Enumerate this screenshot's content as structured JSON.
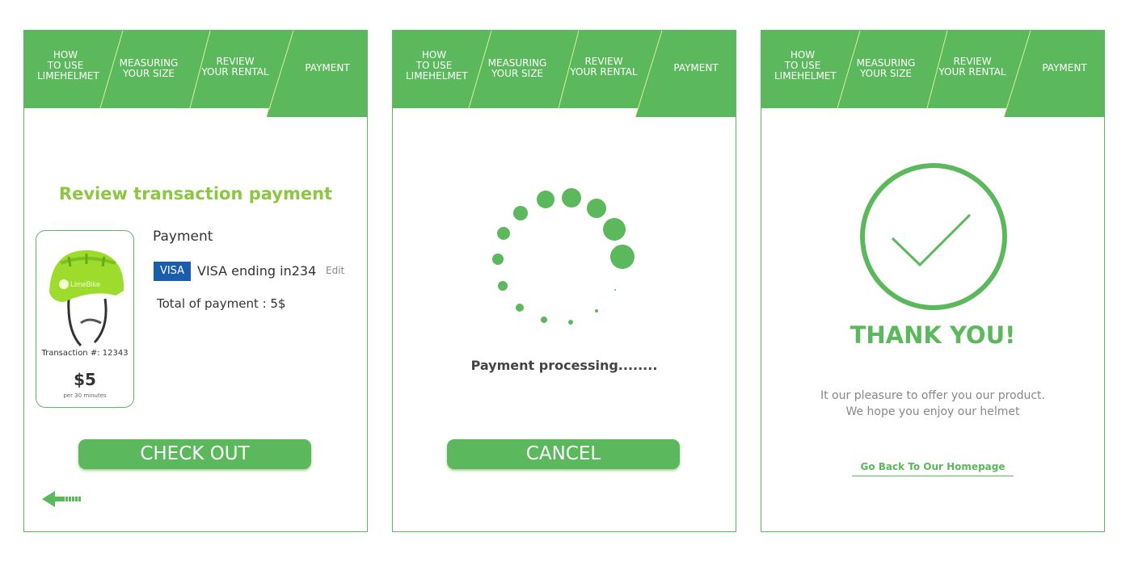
{
  "tabs": [
    {
      "label": "HOW\nTO USE\nLIMEHELMET"
    },
    {
      "label": "MEASURING\nYOUR SIZE"
    },
    {
      "label": "REVIEW\nYOUR RENTAL"
    },
    {
      "label": "PAYMENT"
    }
  ],
  "colors": {
    "accent": "#5cb85c",
    "lime": "#8dc63f",
    "visa": "#1a5dab"
  },
  "review": {
    "title": "Review transaction payment",
    "helmet_brand": "LimeBike",
    "transaction": "Transaction #: 12343",
    "price": "$5",
    "price_unit": "per 30 minutes",
    "payment_heading": "Payment",
    "visa_badge": "VISA",
    "card_text": "VISA ending in234",
    "edit": "Edit",
    "total": "Total of payment : 5$",
    "checkout": "CHECK OUT",
    "back_icon": "back-arrow-icon"
  },
  "processing": {
    "status": "Payment processing........",
    "cancel": "CANCEL"
  },
  "thanks": {
    "title": "THANK YOU!",
    "message_line1": "It our pleasure to offer you our product.",
    "message_line2": "We hope you enjoy our helmet",
    "home_link": "Go Back To Our Homepage"
  }
}
